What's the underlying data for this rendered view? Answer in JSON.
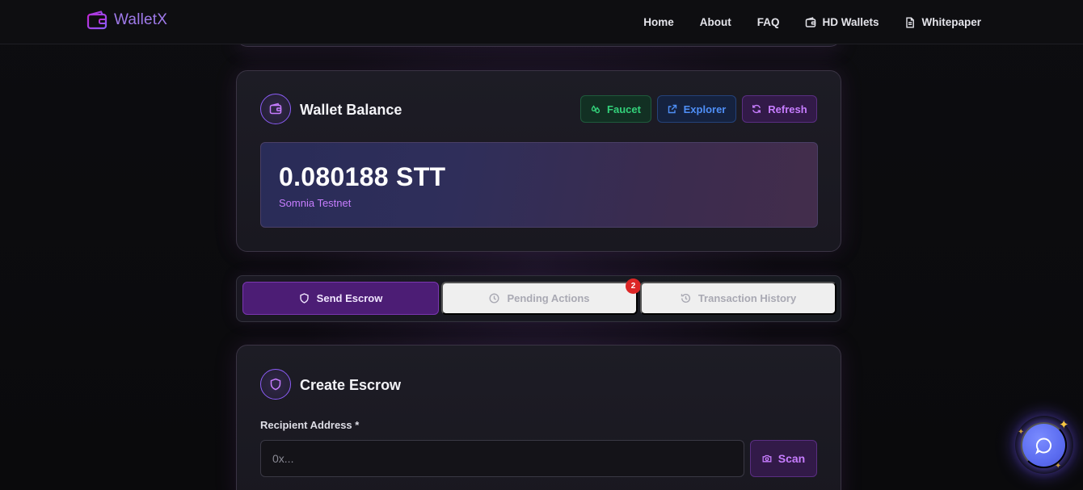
{
  "nav": {
    "brand": "WalletX",
    "links": [
      {
        "label": "Home",
        "icon": null
      },
      {
        "label": "About",
        "icon": null
      },
      {
        "label": "FAQ",
        "icon": null
      },
      {
        "label": "HD Wallets",
        "icon": "wallet-icon"
      },
      {
        "label": "Whitepaper",
        "icon": "document-icon"
      }
    ]
  },
  "balance": {
    "title": "Wallet Balance",
    "amount": "0.080188 STT",
    "network": "Somnia Testnet",
    "buttons": {
      "faucet": "Faucet",
      "explorer": "Explorer",
      "refresh": "Refresh"
    }
  },
  "tabs": {
    "send": "Send Escrow",
    "pending": "Pending Actions",
    "pending_count": "2",
    "history": "Transaction History",
    "active": "send"
  },
  "escrow": {
    "title": "Create Escrow",
    "recipient_label": "Recipient Address *",
    "recipient_placeholder": "0x...",
    "recipient_value": "",
    "scan_label": "Scan"
  },
  "colors": {
    "accent": "#8b5cf6",
    "faucet": "#33d17a",
    "explorer": "#4f8ff7",
    "refresh": "#c77dff",
    "badge": "#dc2626"
  }
}
